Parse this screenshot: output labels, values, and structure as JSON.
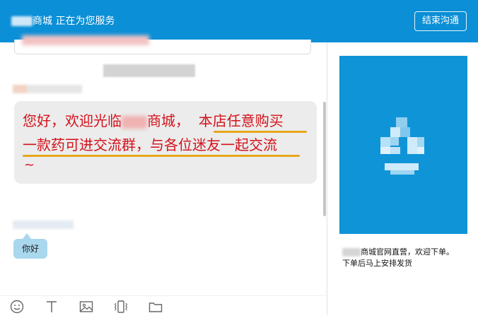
{
  "header": {
    "title": "商城 正在为您服务",
    "end_button": "结束沟通"
  },
  "chat": {
    "message_line1_a": "您好，欢迎光临",
    "message_line1_b": "商城，",
    "message_line1_c": "本店任意购买",
    "message_line2": "一款药可进交流群，与各位迷友一起交流",
    "message_line3": "~",
    "reply": "你好"
  },
  "toolbar": {
    "items": [
      "emoji-icon",
      "text-format-icon",
      "image-icon",
      "vibrate-icon",
      "folder-icon"
    ]
  },
  "sidebar": {
    "promo_line1": "商城官网直营，欢迎下单。",
    "promo_line2": "下单后马上安排发货"
  },
  "colors": {
    "header_bg": "#0b8fd6",
    "message_text": "#d4111a",
    "underline": "#e7a61d",
    "reply_bubble": "#a9d7ee",
    "promo_bg": "#0f94d8"
  }
}
